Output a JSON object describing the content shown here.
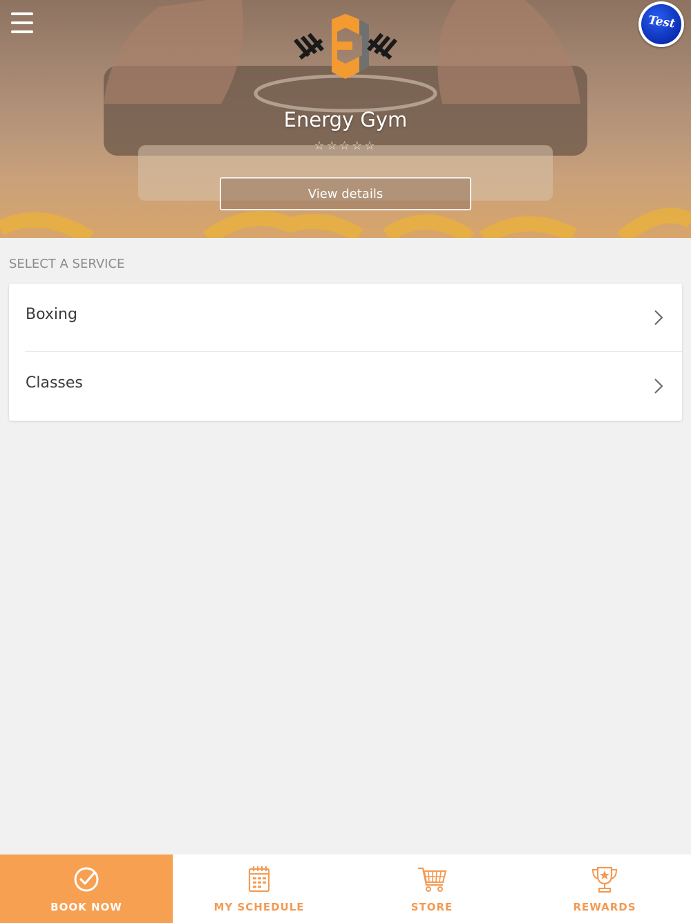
{
  "header": {
    "gym_name": "Energy Gym",
    "rating_stars": "☆☆☆☆☆",
    "view_details_label": "View details",
    "avatar_text": "Test"
  },
  "services": {
    "title": "SELECT A SERVICE",
    "items": [
      {
        "label": "Boxing"
      },
      {
        "label": "Classes"
      }
    ]
  },
  "tabbar": {
    "items": [
      {
        "label": "BOOK NOW",
        "icon": "check-circle-icon",
        "active": true
      },
      {
        "label": "MY SCHEDULE",
        "icon": "calendar-icon",
        "active": false
      },
      {
        "label": "STORE",
        "icon": "shopping-cart-icon",
        "active": false
      },
      {
        "label": "REWARDS",
        "icon": "trophy-icon",
        "active": false
      }
    ]
  },
  "colors": {
    "accent": "#f7a052",
    "background": "#f1f1f1",
    "card": "#ffffff"
  }
}
